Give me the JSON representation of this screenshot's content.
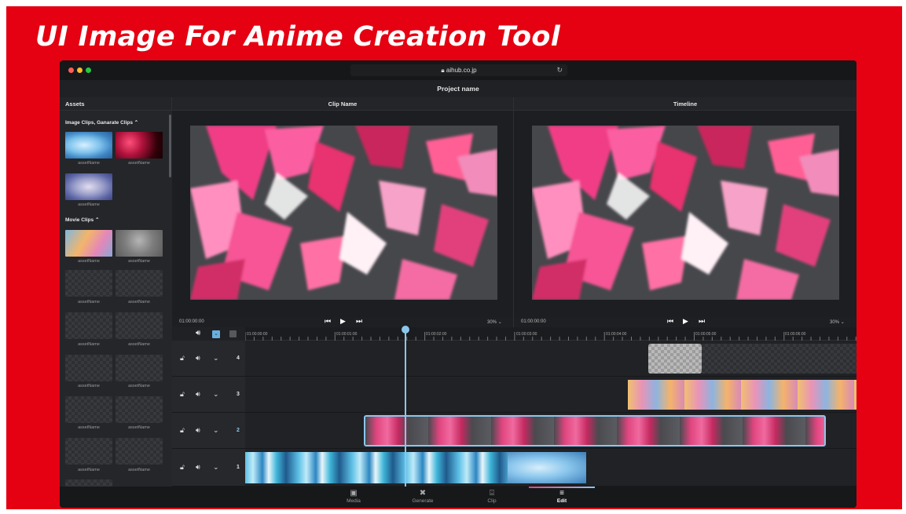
{
  "headline": "UI Image For Anime Creation Tool",
  "browser": {
    "url": "aihub.co.jp",
    "lock_icon": "lock-icon",
    "reload_icon": "reload-icon"
  },
  "project": {
    "name": "Project name"
  },
  "panes": {
    "assets": "Assets",
    "clip": "Clip Name",
    "timeline": "Timeline"
  },
  "assets": {
    "image_section": "Image Clips, Ganarate Clips",
    "movie_section": "Movie Clips",
    "asset_label": "assetName"
  },
  "viewer_left": {
    "timecode": "01:00:00:00",
    "zoom": "30%"
  },
  "viewer_right": {
    "timecode": "01:00:00:00",
    "zoom": "30%"
  },
  "ruler_ticks": [
    "01:00:00:00",
    "01:00:01:00",
    "01:00:02:00",
    "01:00:03:00",
    "01:00:04:00",
    "01:00:05:00",
    "01:00:06:00"
  ],
  "tracks": [
    "4",
    "3",
    "2",
    "1"
  ],
  "nav": [
    {
      "label": "Media",
      "icon": "media-icon",
      "active": false
    },
    {
      "label": "Generate",
      "icon": "generate-icon",
      "active": false
    },
    {
      "label": "Clip",
      "icon": "clip-icon",
      "active": false
    },
    {
      "label": "Edit",
      "icon": "edit-icon",
      "active": true
    }
  ],
  "colors": {
    "banner": "#e50012",
    "accent": "#8bc7ec",
    "app_bg": "#1d1f22"
  }
}
